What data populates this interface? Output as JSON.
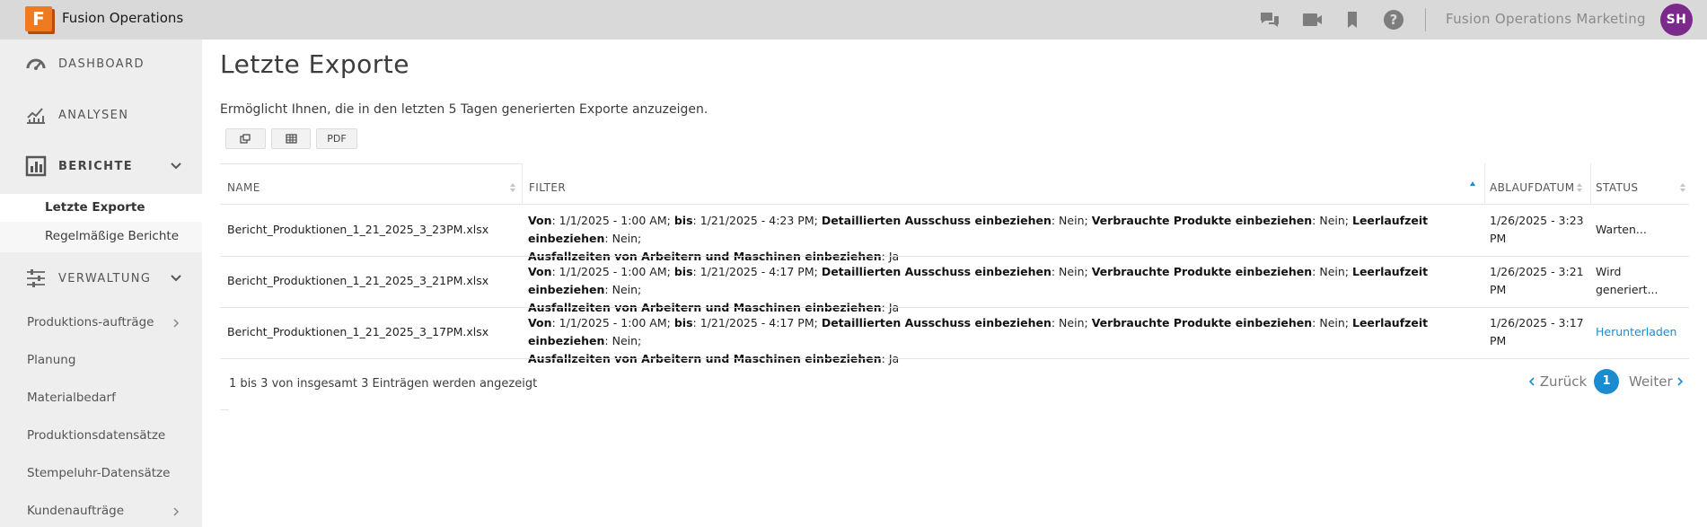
{
  "app": {
    "logo_letter": "F",
    "title": "Fusion Operations"
  },
  "topbar": {
    "icons": [
      "chat-icon",
      "video-icon",
      "bookmark-icon",
      "help-icon"
    ],
    "org_name": "Fusion Operations Marketing",
    "avatar_initials": "SH",
    "avatar_color": "#7b2a8c"
  },
  "sidebar": {
    "main_items": [
      {
        "label": "DASHBOARD",
        "icon": "gauge-icon"
      },
      {
        "label": "ANALYSEN",
        "icon": "line-chart-icon"
      },
      {
        "label": "BERICHTE",
        "icon": "bar-chart-icon"
      },
      {
        "label": "VERWALTUNG",
        "icon": "sliders-icon"
      }
    ],
    "report_sub_items": [
      "Letzte Exporte",
      "Regelmäßige Berichte"
    ],
    "management_items": [
      "Produktions-aufträge",
      "Planung",
      "Materialbedarf",
      "Produktionsdatensätze",
      "Stempeluhr-Datensätze",
      "Kundenaufträge"
    ]
  },
  "main": {
    "title": "Letzte Exporte",
    "description": "Ermöglicht Ihnen, die in den letzten 5 Tagen generierten Exporte anzuzeigen.",
    "toolbar": {
      "copy_icon": "copy-icon",
      "csv_icon": "table-icon",
      "pdf_label": "PDF"
    },
    "table": {
      "columns": [
        "NAME",
        "FILTER",
        "ABLAUFDATUM",
        "STATUS"
      ],
      "filter_labels": {
        "from": "Von",
        "to": "bis",
        "scrap": "Detaillierten Ausschuss einbeziehen",
        "consumed": "Verbrauchte Produkte einbeziehen",
        "idle": "Leerlaufzeit einbeziehen",
        "downtime": "Ausfallzeiten von Arbeitern und Maschinen einbeziehen"
      },
      "rows": [
        {
          "name": "Bericht_Produktionen_1_21_2025_3_23PM.xlsx",
          "from": ": 1/1/2025 - 1:00 AM; ",
          "to": ": 1/21/2025 - 4:23 PM; ",
          "scrap": ": Nein; ",
          "consumed": ": Nein; ",
          "idle": ": Nein;",
          "downtime": ": Ja",
          "expiry_line1": "1/26/2025 - 3:23",
          "expiry_line2": "PM",
          "status_line1": "Warten...",
          "status_line2": ""
        },
        {
          "name": "Bericht_Produktionen_1_21_2025_3_21PM.xlsx",
          "from": ": 1/1/2025 - 1:00 AM; ",
          "to": ": 1/21/2025 - 4:17 PM; ",
          "scrap": ": Nein; ",
          "consumed": ": Nein; ",
          "idle": ": Nein;",
          "downtime": ": Ja",
          "expiry_line1": "1/26/2025 - 3:21",
          "expiry_line2": "PM",
          "status_line1": "Wird",
          "status_line2": "generiert..."
        },
        {
          "name": "Bericht_Produktionen_1_21_2025_3_17PM.xlsx",
          "from": ": 1/1/2025 - 1:00 AM; ",
          "to": ": 1/21/2025 - 4:17 PM; ",
          "scrap": ": Nein; ",
          "consumed": ": Nein; ",
          "idle": ": Nein;",
          "downtime": ": Ja",
          "expiry_line1": "1/26/2025 - 3:17",
          "expiry_line2": "PM",
          "status_line1": "Herunterladen",
          "status_line2": ""
        }
      ]
    },
    "footer": {
      "info": "1 bis 3 von insgesamt 3 Einträgen werden angezeigt",
      "prev": "Zurück",
      "current_page": "1",
      "next": "Weiter"
    }
  }
}
